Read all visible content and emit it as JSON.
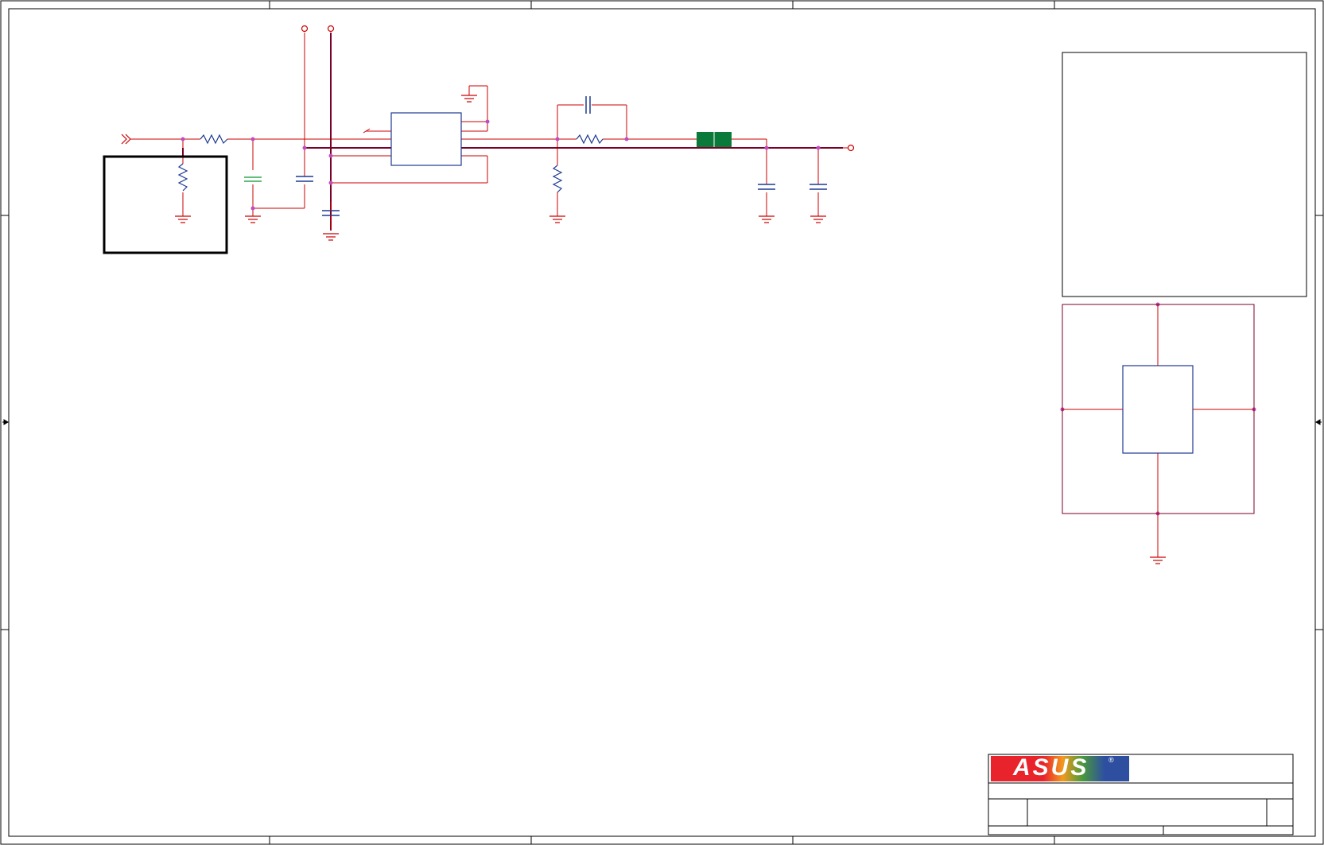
{
  "schematic": {
    "company_logo": "ASUS",
    "logo_registered_mark": "®",
    "title_block": {
      "title": "",
      "sheet_name": "",
      "rev": "",
      "date": "",
      "sheet": ""
    },
    "colors": {
      "wire": "#cc0000",
      "bus_wire": "#7a0026",
      "component": "#1f3a93",
      "junction": "#c04dc0",
      "inductor": "#0a7a3a",
      "frame": "#000000",
      "cap_alt": "#2fa84f"
    },
    "icons": [
      "ground-symbol",
      "power-port",
      "off-page-connector",
      "resistor",
      "capacitor",
      "ferrite-bead",
      "ic-chip"
    ]
  }
}
